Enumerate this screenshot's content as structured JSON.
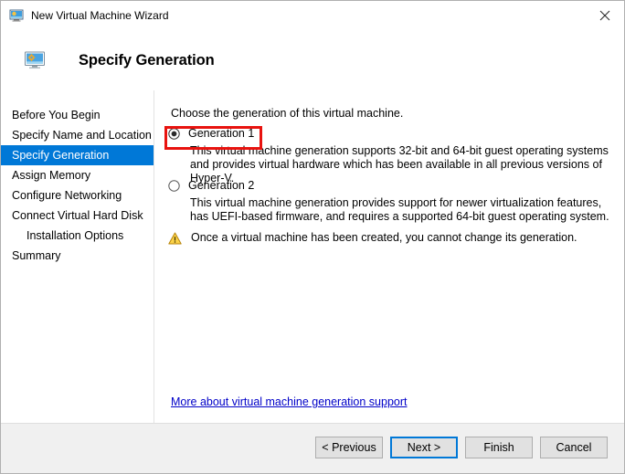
{
  "window": {
    "title": "New Virtual Machine Wizard",
    "title_icon": "virtual-machine-monitor-icon",
    "close_label": "✕"
  },
  "header": {
    "title": "Specify Generation",
    "icon": "virtual-machine-monitor-icon"
  },
  "sidebar": {
    "items": [
      {
        "label": "Before You Begin",
        "selected": false,
        "indent": false
      },
      {
        "label": "Specify Name and Location",
        "selected": false,
        "indent": false
      },
      {
        "label": "Specify Generation",
        "selected": true,
        "indent": false
      },
      {
        "label": "Assign Memory",
        "selected": false,
        "indent": false
      },
      {
        "label": "Configure Networking",
        "selected": false,
        "indent": false
      },
      {
        "label": "Connect Virtual Hard Disk",
        "selected": false,
        "indent": false
      },
      {
        "label": "Installation Options",
        "selected": false,
        "indent": true
      },
      {
        "label": "Summary",
        "selected": false,
        "indent": false
      }
    ]
  },
  "content": {
    "intro": "Choose the generation of this virtual machine.",
    "generation1": {
      "label": "Generation 1",
      "selected": true,
      "description": "This virtual machine generation supports 32-bit and 64-bit guest operating systems and provides virtual hardware which has been available in all previous versions of Hyper-V."
    },
    "generation2": {
      "label": "Generation 2",
      "selected": false,
      "description": "This virtual machine generation provides support for newer virtualization features, has UEFI-based firmware, and requires a supported 64-bit guest operating system."
    },
    "warning": {
      "icon": "warning-triangle-icon",
      "text": "Once a virtual machine has been created, you cannot change its generation."
    },
    "help_link": "More about virtual machine generation support"
  },
  "footer": {
    "buttons": [
      {
        "label": "< Previous",
        "focused": false
      },
      {
        "label": "Next >",
        "focused": true
      },
      {
        "label": "Finish",
        "focused": false
      },
      {
        "label": "Cancel",
        "focused": false
      }
    ]
  },
  "annotation": {
    "color": "#e8130f",
    "target": "generation-1-radio"
  }
}
